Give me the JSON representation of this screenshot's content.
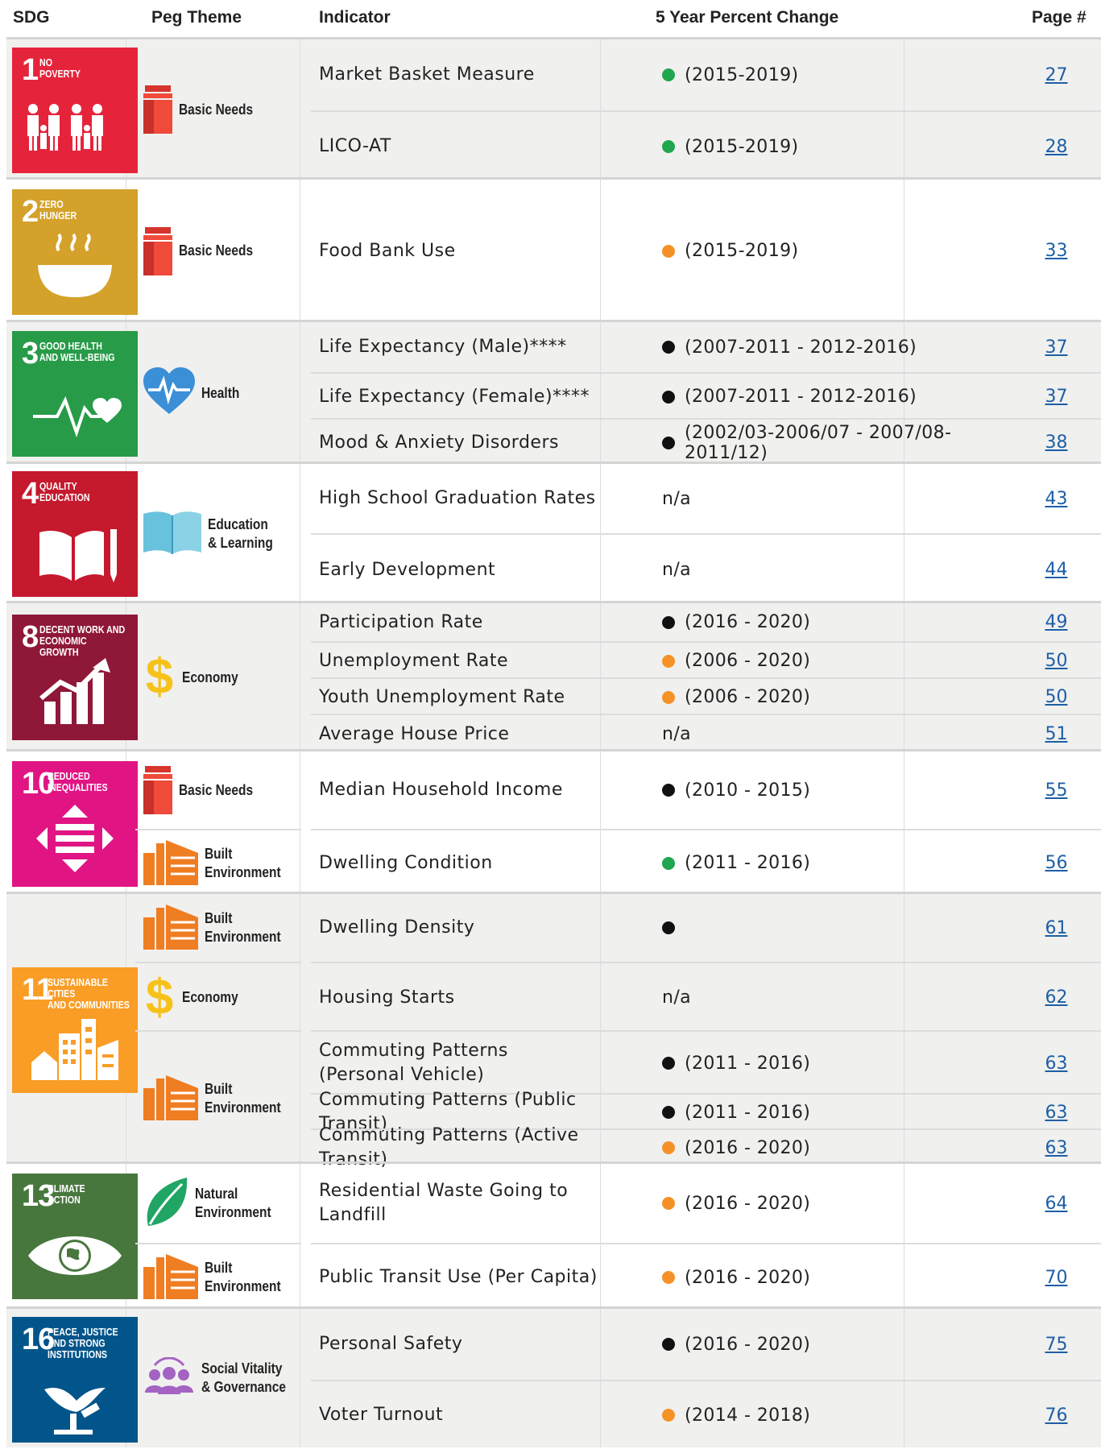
{
  "headers": {
    "sdg": "SDG",
    "peg": "Peg Theme",
    "indicator": "Indicator",
    "change": "5 Year Percent Change",
    "page": "Page #"
  },
  "colors": {
    "green": "#1fa64e",
    "orange": "#f59227",
    "black": "#111111",
    "link": "#1d5fa5"
  },
  "sdgs": [
    {
      "num": "1",
      "label": "NO\nPOVERTY",
      "color": "#e5243b"
    },
    {
      "num": "2",
      "label": "ZERO\nHUNGER",
      "color": "#d4a12a"
    },
    {
      "num": "3",
      "label": "GOOD HEALTH\nAND WELL-BEING",
      "color": "#279b48"
    },
    {
      "num": "4",
      "label": "QUALITY\nEDUCATION",
      "color": "#c5192d"
    },
    {
      "num": "8",
      "label": "DECENT WORK AND\nECONOMIC GROWTH",
      "color": "#8f1838"
    },
    {
      "num": "10",
      "label": "REDUCED\nINEQUALITIES",
      "color": "#e11484"
    },
    {
      "num": "11",
      "label": "SUSTAINABLE CITIES\nAND COMMUNITIES",
      "color": "#f99d26"
    },
    {
      "num": "13",
      "label": "CLIMATE\nACTION",
      "color": "#48773e"
    },
    {
      "num": "16",
      "label": "PEACE, JUSTICE\nAND STRONG\nINSTITUTIONS",
      "color": "#02558b"
    }
  ],
  "pegs": [
    {
      "label": "Basic Needs",
      "icon": "milk-carton-icon"
    },
    {
      "label": "Basic Needs",
      "icon": "milk-carton-icon"
    },
    {
      "label": "Health",
      "icon": "heart-pulse-icon"
    },
    {
      "label": "Education\n& Learning",
      "icon": "open-book-icon"
    },
    {
      "label": "Economy",
      "icon": "dollar-icon"
    },
    {
      "label": "Basic Needs",
      "icon": "milk-carton-icon"
    },
    {
      "label": "Built\nEnvironment",
      "icon": "buildings-icon"
    },
    {
      "label": "Built\nEnvironment",
      "icon": "buildings-icon"
    },
    {
      "label": "Economy",
      "icon": "dollar-icon"
    },
    {
      "label": "Built\nEnvironment",
      "icon": "buildings-icon"
    },
    {
      "label": "Natural\nEnvironment",
      "icon": "leaf-icon"
    },
    {
      "label": "Built\nEnvironment",
      "icon": "buildings-icon"
    },
    {
      "label": "Social Vitality\n& Governance",
      "icon": "people-icon"
    }
  ],
  "rows": [
    {
      "indicator": "Market Basket Measure",
      "dot": "green",
      "period": "(2015-2019)",
      "page": "27"
    },
    {
      "indicator": "LICO-AT",
      "dot": "green",
      "period": "(2015-2019)",
      "page": "28"
    },
    {
      "indicator": "Food Bank Use",
      "dot": "orange",
      "period": "(2015-2019)",
      "page": "33"
    },
    {
      "indicator": "Life Expectancy (Male)****",
      "dot": "black",
      "period": "(2007-2011 - 2012-2016)",
      "page": "37"
    },
    {
      "indicator": "Life Expectancy (Female)****",
      "dot": "black",
      "period": "(2007-2011 - 2012-2016)",
      "page": "37"
    },
    {
      "indicator": "Mood & Anxiety Disorders",
      "dot": "black",
      "period": "(2002/03-2006/07 - 2007/08-2011/12)",
      "page": "38"
    },
    {
      "indicator": "High School Graduation Rates",
      "dot": "",
      "period": "n/a",
      "page": "43"
    },
    {
      "indicator": "Early Development",
      "dot": "",
      "period": "n/a",
      "page": "44"
    },
    {
      "indicator": "Participation Rate",
      "dot": "black",
      "period": "(2016 - 2020)",
      "page": "49"
    },
    {
      "indicator": "Unemployment Rate",
      "dot": "orange",
      "period": "(2006 - 2020)",
      "page": "50"
    },
    {
      "indicator": "Youth Unemployment Rate",
      "dot": "orange",
      "period": "(2006 - 2020)",
      "page": "50"
    },
    {
      "indicator": "Average House Price",
      "dot": "",
      "period": "n/a",
      "page": "51"
    },
    {
      "indicator": "Median Household Income",
      "dot": "black",
      "period": "(2010 - 2015)",
      "page": "55"
    },
    {
      "indicator": "Dwelling Condition",
      "dot": "green",
      "period": "(2011 - 2016)",
      "page": "56"
    },
    {
      "indicator": "Dwelling Density",
      "dot": "black",
      "period": "",
      "page": "61"
    },
    {
      "indicator": "Housing Starts",
      "dot": "",
      "period": "n/a",
      "page": "62"
    },
    {
      "indicator": "Commuting Patterns\n(Personal Vehicle)",
      "dot": "black",
      "period": "(2011 - 2016)",
      "page": "63"
    },
    {
      "indicator": "Commuting Patterns (Public Transit)",
      "dot": "black",
      "period": "(2011 - 2016)",
      "page": "63"
    },
    {
      "indicator": "Commuting Patterns (Active Transit)",
      "dot": "orange",
      "period": "(2016 - 2020)",
      "page": "63"
    },
    {
      "indicator": "Residential Waste Going to Landfill",
      "dot": "orange",
      "period": "(2016 - 2020)",
      "page": "64"
    },
    {
      "indicator": "Public Transit Use (Per Capita)",
      "dot": "orange",
      "period": "(2016 - 2020)",
      "page": "70"
    },
    {
      "indicator": "Personal Safety",
      "dot": "black",
      "period": "(2016 - 2020)",
      "page": "75"
    },
    {
      "indicator": "Voter Turnout",
      "dot": "orange",
      "period": "(2014 - 2018)",
      "page": "76"
    }
  ]
}
